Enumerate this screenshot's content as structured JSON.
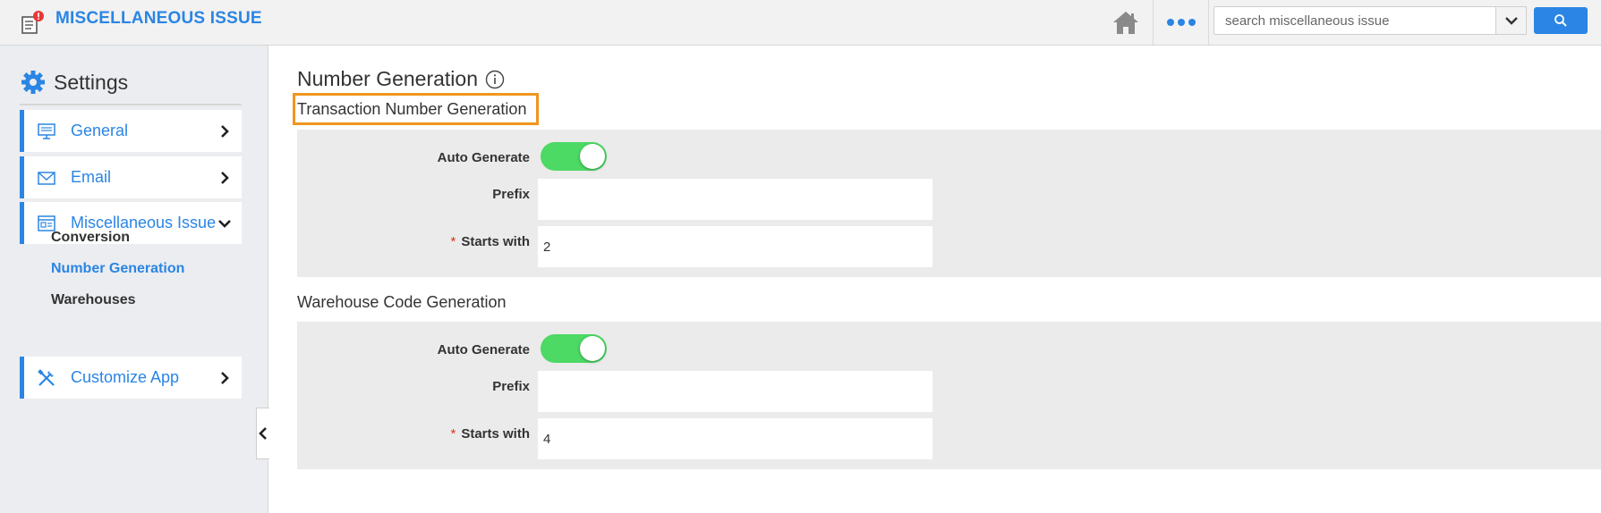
{
  "app": {
    "title": "MISCELLANEOUS ISSUE",
    "icon": "receipt-alert-icon"
  },
  "topbar": {
    "home_icon": "home-icon",
    "more_icon": "more-dots-icon",
    "search_placeholder": "search miscellaneous issue",
    "search_dropdown_icon": "chevron-down-icon",
    "search_button_icon": "search-icon"
  },
  "sidebar": {
    "title": "Settings",
    "title_icon": "gear-icon",
    "items": [
      {
        "label": "General",
        "icon": "monitor-icon",
        "expanded": false
      },
      {
        "label": "Email",
        "icon": "envelope-icon",
        "expanded": false
      },
      {
        "label": "Miscellaneous Issue",
        "icon": "document-list-icon",
        "expanded": true
      },
      {
        "label": "Customize App",
        "icon": "tools-icon",
        "expanded": false
      }
    ],
    "subitems": [
      {
        "label": "Conversion",
        "active": false
      },
      {
        "label": "Number Generation",
        "active": true
      },
      {
        "label": "Warehouses",
        "active": false
      }
    ]
  },
  "main": {
    "page_title": "Number Generation",
    "sections": [
      {
        "title": "Transaction Number Generation",
        "highlighted": true,
        "auto_generate_label": "Auto Generate",
        "auto_generate": true,
        "prefix_label": "Prefix",
        "prefix_value": "",
        "starts_with_label": "Starts with",
        "starts_with_required": "*",
        "starts_with_value": "2"
      },
      {
        "title": "Warehouse Code Generation",
        "highlighted": false,
        "auto_generate_label": "Auto Generate",
        "auto_generate": true,
        "prefix_label": "Prefix",
        "prefix_value": "",
        "starts_with_label": "Starts with",
        "starts_with_required": "*",
        "starts_with_value": "4"
      }
    ]
  },
  "colors": {
    "accent": "#2a85e4",
    "toggle_on": "#4cd964",
    "highlight": "#f0961e",
    "required": "#e0321e"
  }
}
